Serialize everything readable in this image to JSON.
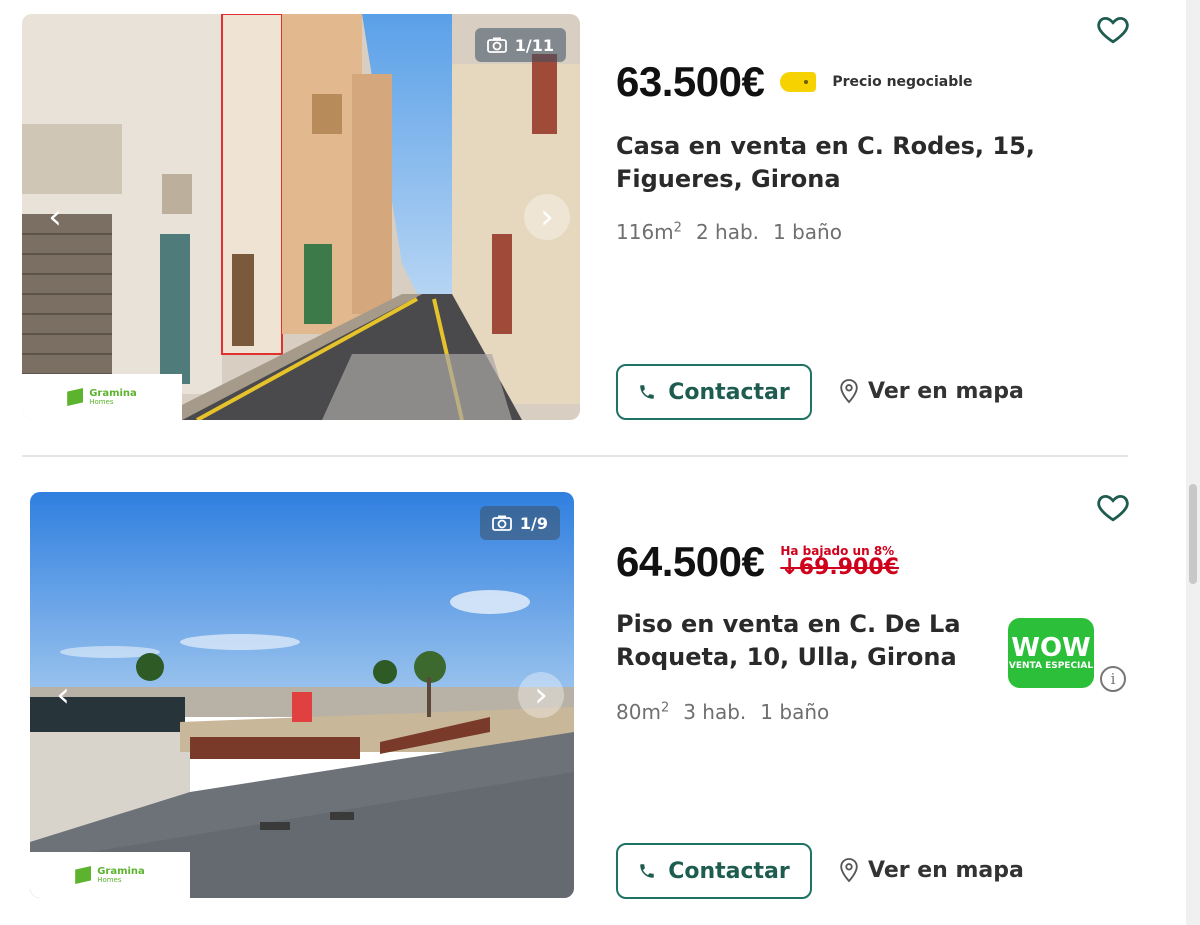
{
  "listings": [
    {
      "photo_counter": "1/11",
      "agency_name": "Gramina",
      "agency_sub": "Homes",
      "price": "63.500€",
      "negotiable_label": "Precio negociable",
      "title": "Casa en venta en C. Rodes, 15, Figueres, Girona",
      "area_value": "116m",
      "area_unit": "2",
      "rooms": "2 hab.",
      "baths": "1 baño",
      "contact_label": "Contactar",
      "map_label": "Ver en mapa"
    },
    {
      "photo_counter": "1/9",
      "agency_name": "Gramina",
      "agency_sub": "Homes",
      "price": "64.500€",
      "drop_label": "Ha bajado un 8%",
      "old_price": "↓69.900€",
      "title": "Piso en venta en C. De La Roqueta, 10, Ulla, Girona",
      "area_value": "80m",
      "area_unit": "2",
      "rooms": "3 hab.",
      "baths": "1 baño",
      "badge_main": "¡WOW!",
      "badge_sub": "VENTA ESPECIAL",
      "contact_label": "Contactar",
      "map_label": "Ver en mapa"
    }
  ],
  "colors": {
    "accent": "#1e7363",
    "price_drop": "#d0021b",
    "wow_badge": "#2bbf3a",
    "negotiable_tag": "#f5d200"
  },
  "icons": [
    "camera-icon",
    "chevron-left-icon",
    "chevron-right-icon",
    "heart-icon",
    "phone-icon",
    "map-pin-icon",
    "info-icon"
  ]
}
